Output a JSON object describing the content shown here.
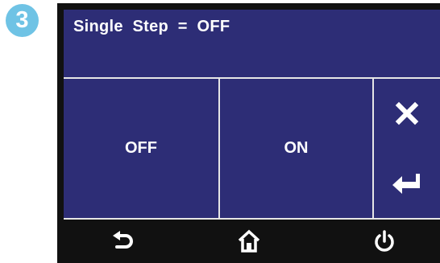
{
  "step_badge": "3",
  "header": {
    "text": "Single  Step  =  OFF"
  },
  "options": [
    {
      "label": "OFF"
    },
    {
      "label": "ON"
    }
  ],
  "side_buttons": {
    "cancel_icon": "close-icon",
    "enter_icon": "enter-icon"
  },
  "bottom_nav": {
    "items": [
      "back-icon",
      "home-icon",
      "power-icon"
    ]
  },
  "colors": {
    "screen_bg": "#2d2d76",
    "frame": "#111111",
    "badge": "#6fc3e5",
    "text": "#ffffff"
  }
}
